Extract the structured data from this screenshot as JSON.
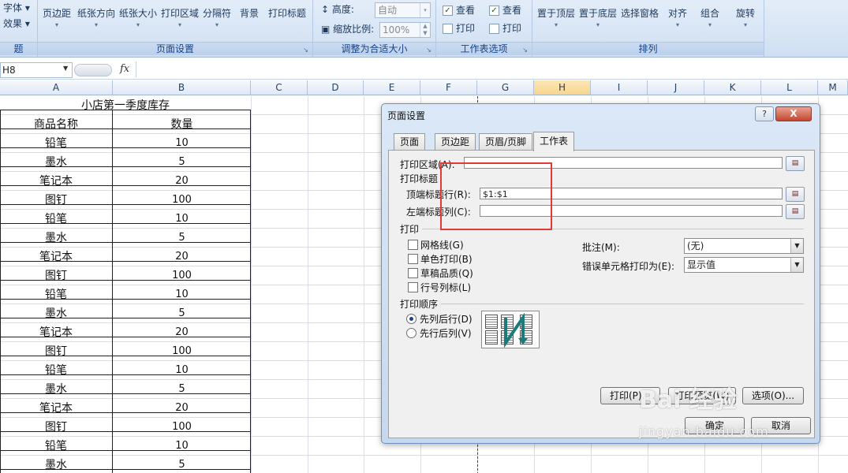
{
  "ribbon": {
    "theme_group": {
      "fonts": "字体",
      "effects": "效果"
    },
    "page_setup": {
      "label": "页面设置",
      "buttons": [
        "页边距",
        "纸张方向",
        "纸张大小",
        "打印区域",
        "分隔符",
        "背景",
        "打印标题"
      ]
    },
    "scale_to_fit": {
      "label": "调整为合适大小",
      "height_label": "高度:",
      "height_value": "自动",
      "scale_label": "缩放比例:",
      "scale_value": "100%"
    },
    "sheet_options": {
      "label": "工作表选项",
      "view1": "查看",
      "print1": "打印",
      "view2": "查看",
      "print2": "打印"
    },
    "arrange": {
      "label": "排列",
      "buttons": [
        "置于顶层",
        "置于底层",
        "选择窗格",
        "对齐",
        "组合",
        "旋转"
      ]
    }
  },
  "formula_bar": {
    "name_box": "H8",
    "fx": "fx"
  },
  "sheet": {
    "columns": [
      "A",
      "B",
      "C",
      "D",
      "E",
      "F",
      "G",
      "H",
      "I",
      "J",
      "K",
      "L",
      "M"
    ],
    "selected_column": "H",
    "title": "小店第一季度库存",
    "header": {
      "name": "商品名称",
      "qty": "数量"
    },
    "rows": [
      {
        "name": "铅笔",
        "qty": "10"
      },
      {
        "name": "墨水",
        "qty": "5"
      },
      {
        "name": "笔记本",
        "qty": "20"
      },
      {
        "name": "图钉",
        "qty": "100"
      },
      {
        "name": "铅笔",
        "qty": "10"
      },
      {
        "name": "墨水",
        "qty": "5"
      },
      {
        "name": "笔记本",
        "qty": "20"
      },
      {
        "name": "图钉",
        "qty": "100"
      },
      {
        "name": "铅笔",
        "qty": "10"
      },
      {
        "name": "墨水",
        "qty": "5"
      },
      {
        "name": "笔记本",
        "qty": "20"
      },
      {
        "name": "图钉",
        "qty": "100"
      },
      {
        "name": "铅笔",
        "qty": "10"
      },
      {
        "name": "墨水",
        "qty": "5"
      },
      {
        "name": "笔记本",
        "qty": "20"
      },
      {
        "name": "图钉",
        "qty": "100"
      },
      {
        "name": "铅笔",
        "qty": "10"
      },
      {
        "name": "墨水",
        "qty": "5"
      }
    ]
  },
  "dialog": {
    "title": "页面设置",
    "help": "?",
    "close": "X",
    "tabs": [
      "页面",
      "页边距",
      "页眉/页脚",
      "工作表"
    ],
    "active_tab": "工作表",
    "print_area_label": "打印区域(A):",
    "print_area_value": "",
    "print_titles_label": "打印标题",
    "rows_repeat_label": "顶端标题行(R):",
    "rows_repeat_value": "$1:$1",
    "cols_repeat_label": "左端标题列(C):",
    "cols_repeat_value": "",
    "print_label": "打印",
    "gridlines": "网格线(G)",
    "black_white": "单色打印(B)",
    "draft": "草稿品质(Q)",
    "row_col_headings": "行号列标(L)",
    "comments_label": "批注(M):",
    "comments_value": "(无)",
    "errors_label": "错误单元格打印为(E):",
    "errors_value": "显示值",
    "page_order_label": "打印顺序",
    "down_then_over": "先列后行(D)",
    "over_then_down": "先行后列(V)",
    "print_btn": "打印(P)...",
    "preview_btn": "打印预览(W)",
    "options_btn": "选项(O)...",
    "ok_btn": "确定",
    "cancel_btn": "取消"
  },
  "watermark": {
    "text": "Bai 经验",
    "url": "jingyan.baidu.com"
  }
}
